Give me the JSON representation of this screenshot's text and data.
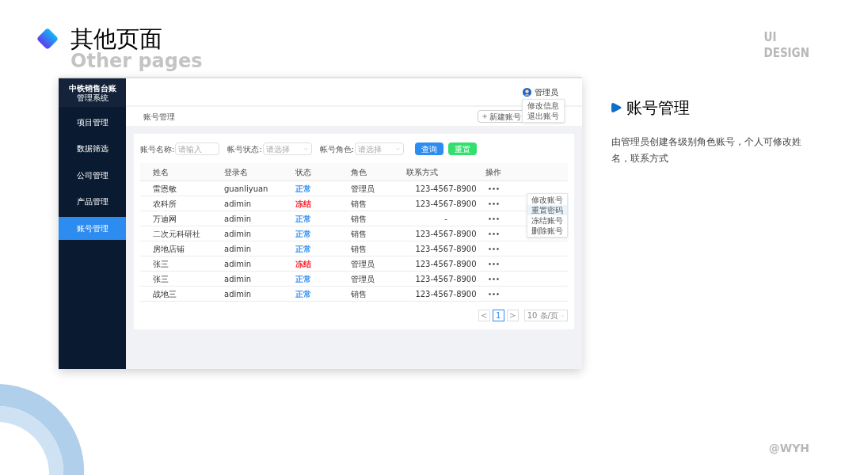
{
  "slide": {
    "title": "其他页面",
    "subtitle": "Other pages",
    "brand": [
      "UI",
      "DESIGN"
    ],
    "signature": "@WYH"
  },
  "app": {
    "logo": {
      "title": "中铁销售台账",
      "subtitle": "管理系统"
    },
    "sidebar": {
      "items": [
        {
          "label": "项目管理",
          "selected": false
        },
        {
          "label": "数据筛选",
          "selected": false
        },
        {
          "label": "公司管理",
          "selected": false
        },
        {
          "label": "产品管理",
          "selected": false
        },
        {
          "label": "账号管理",
          "selected": true
        }
      ]
    },
    "user": {
      "name": "管理员",
      "menu": [
        "修改信息",
        "退出账号"
      ]
    },
    "breadcrumb": "账号管理",
    "new_button": "新建账号",
    "filters": [
      {
        "label": "账号名称:",
        "placeholder": "请输入",
        "kind": "input"
      },
      {
        "label": "帐号状态:",
        "placeholder": "请选择",
        "kind": "select"
      },
      {
        "label": "帐号角色:",
        "placeholder": "请选择",
        "kind": "select"
      }
    ],
    "buttons": [
      {
        "label": "查询",
        "kind": "primary"
      },
      {
        "label": "重置",
        "kind": "success"
      }
    ],
    "table": {
      "columns": [
        "姓名",
        "登录名",
        "状态",
        "角色",
        "联系方式",
        "操作"
      ],
      "rows": [
        {
          "name": "雷恩敏",
          "login": "guanliyuan",
          "status": {
            "text": "正常",
            "color": "#2d8cf0"
          },
          "role": "管理员",
          "phone": "123-4567-8900",
          "actions_visible": true
        },
        {
          "name": "农科所",
          "login": "adimin",
          "status": {
            "text": "冻结",
            "color": "#f5222d"
          },
          "role": "销售",
          "phone": "123-4567-8900",
          "actions_visible": true
        },
        {
          "name": "万迪网",
          "login": "adimin",
          "status": {
            "text": "正常",
            "color": "#2d8cf0"
          },
          "role": "销售",
          "phone": "-",
          "actions_visible": true
        },
        {
          "name": "二次元科研社",
          "login": "adimin",
          "status": {
            "text": "正常",
            "color": "#2d8cf0"
          },
          "role": "销售",
          "phone": "123-4567-8900",
          "actions_visible": true
        },
        {
          "name": "房地店铺",
          "login": "adimin",
          "status": {
            "text": "正常",
            "color": "#2d8cf0"
          },
          "role": "销售",
          "phone": "123-4567-8900",
          "actions_visible": true
        },
        {
          "name": "张三",
          "login": "adimin",
          "status": {
            "text": "冻结",
            "color": "#f5222d"
          },
          "role": "管理员",
          "phone": "123-4567-8900",
          "actions_visible": true
        },
        {
          "name": "张三",
          "login": "adimin",
          "status": {
            "text": "正常",
            "color": "#2d8cf0"
          },
          "role": "管理员",
          "phone": "123-4567-8900",
          "actions_visible": true
        },
        {
          "name": "战地三",
          "login": "adimin",
          "status": {
            "text": "正常",
            "color": "#2d8cf0"
          },
          "role": "销售",
          "phone": "123-4567-8900",
          "actions_visible": true
        }
      ]
    },
    "row_menu": [
      {
        "label": "修改账号",
        "selected": false
      },
      {
        "label": "重置密码",
        "selected": true
      },
      {
        "label": "冻结账号",
        "selected": false
      },
      {
        "label": "删除账号",
        "selected": false
      }
    ],
    "pagination": {
      "prev": "<",
      "pages": [
        {
          "label": "1",
          "selected": true
        }
      ],
      "next": ">",
      "page_size": "10 条/页"
    }
  },
  "section": {
    "title": "账号管理",
    "description": "由管理员创建各级别角色账号，个人可修改姓名，联系方式"
  }
}
